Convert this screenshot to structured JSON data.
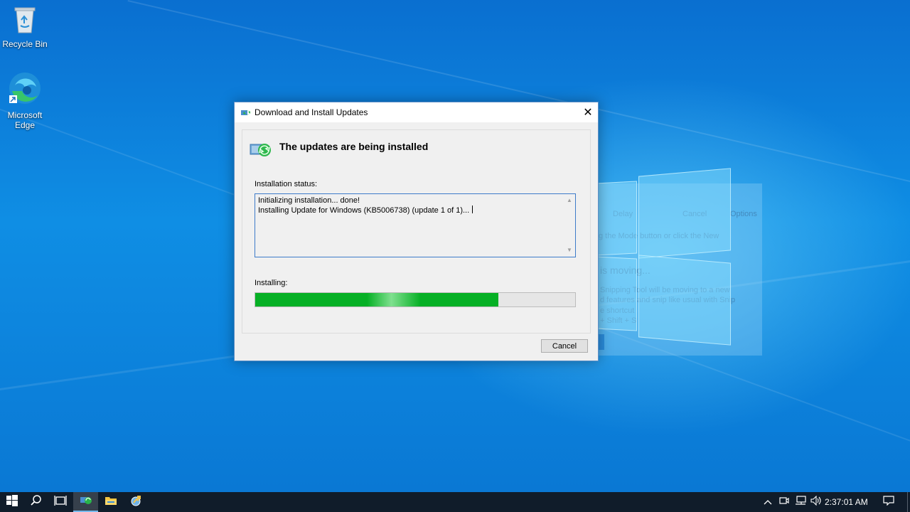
{
  "desktop": {
    "icons": [
      {
        "label": "Recycle Bin",
        "icon": "recycle-bin-icon"
      },
      {
        "label": "Microsoft\nEdge",
        "icon": "edge-icon"
      }
    ],
    "background_ghost": {
      "toolbar": [
        "Delay",
        "Cancel",
        "Options"
      ],
      "mode_hint": "g the Mode button or click the New",
      "heading": "is moving...",
      "body_lines": [
        "Snipping Tool will be moving to a new",
        "d features and snip like usual with Snip",
        "e shortcut",
        "+ Shift + S"
      ]
    }
  },
  "dialog": {
    "title": "Download and Install Updates",
    "heading": "The updates are being installed",
    "status_label": "Installation status:",
    "status_lines": "Initializing installation... done!\nInstalling Update for Windows (KB5006738) (update 1 of 1)...",
    "progress_label": "Installing:",
    "progress_fraction": 0.76,
    "cancel_label": "Cancel"
  },
  "taskbar": {
    "clock": "2:37:01 AM",
    "pinned": [
      "start-icon",
      "search-icon",
      "task-view-icon",
      "windows-update-icon",
      "file-explorer-icon",
      "control-panel-icon"
    ],
    "tray": [
      "chevron-up-icon",
      "meet-now-icon",
      "network-icon",
      "volume-icon",
      "notification-icon"
    ]
  },
  "colors": {
    "accent": "#0078d7",
    "progress": "#06b025",
    "taskbar": "#101c2a"
  }
}
